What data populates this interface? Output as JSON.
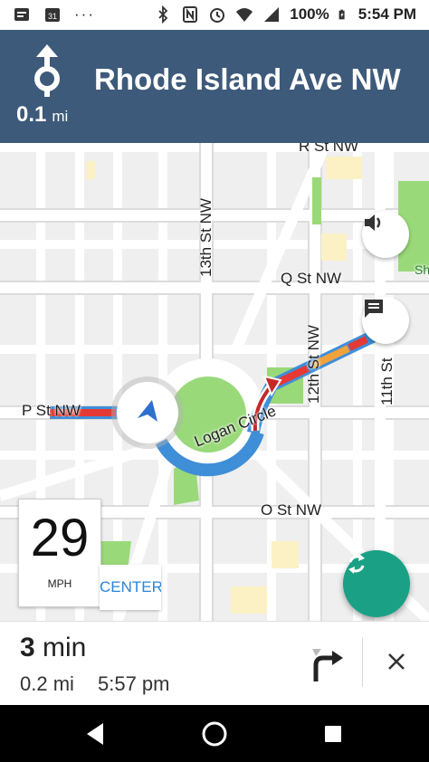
{
  "status_bar": {
    "battery": "100%",
    "time": "5:54 PM",
    "calendar_day": "31"
  },
  "navigation": {
    "distance_value": "0.1",
    "distance_unit": "mi",
    "street": "Rhode Island Ave NW"
  },
  "map": {
    "labels": {
      "r_st": "R St NW",
      "thirteenth_st": "13th St NW",
      "q_st": "Q St NW",
      "twelfth_st": "12th St NW",
      "eleventh_st": "11th St",
      "p_st": "P St NW",
      "logan_circle": "Logan Circle",
      "o_st": "O St NW",
      "sh_partial": "Sh"
    },
    "speed": {
      "value": "29",
      "unit": "MPH"
    },
    "recenter_label": "CENTER"
  },
  "trip": {
    "minutes": "3",
    "minutes_unit": "min",
    "distance": "0.2 mi",
    "arrival": "5:57 pm"
  },
  "colors": {
    "header_bg": "#3d5a7a",
    "route_blue": "#3f8ed8",
    "traffic_red": "#e53935",
    "traffic_orange": "#f2a23b",
    "reroute_green": "#1aa085",
    "park_green": "#9ad97a"
  },
  "icons": {
    "volume": "speaker-icon",
    "report": "chat-icon",
    "reroute": "refresh-icon",
    "next_turn": "turn-right-icon",
    "close": "close-icon"
  }
}
